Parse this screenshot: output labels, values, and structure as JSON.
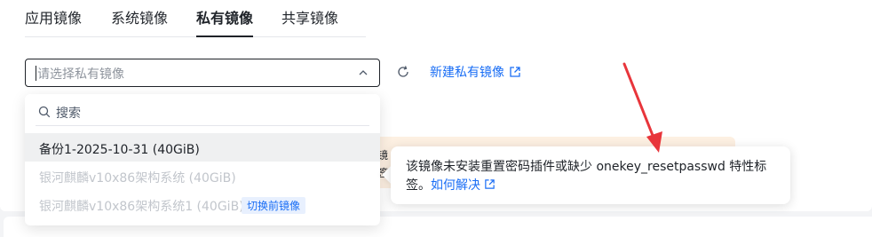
{
  "tabs": [
    {
      "label": "应用镜像",
      "active": false
    },
    {
      "label": "系统镜像",
      "active": false
    },
    {
      "label": "私有镜像",
      "active": true
    },
    {
      "label": "共享镜像",
      "active": false
    }
  ],
  "select": {
    "placeholder": "请选择私有镜像",
    "chevron_icon": "chevron-up-icon"
  },
  "refresh_icon": "refresh-icon",
  "new_image_link": {
    "label": "新建私有镜像",
    "icon": "external-link-icon"
  },
  "dropdown": {
    "search_placeholder": "搜索",
    "search_icon": "search-icon",
    "items": [
      {
        "label": "备份1-2025-10-31 (40GiB)",
        "state": "selected"
      },
      {
        "label": "银河麒麟v10x86架构系统 (40GiB)",
        "state": "disabled"
      },
      {
        "label": "银河麒麟v10x86架构系统1 (40GiB)",
        "state": "disabled",
        "badge": "切换前镜像"
      }
    ]
  },
  "notice": {
    "fragment_1": "镜",
    "fragment_2": "签"
  },
  "tooltip": {
    "line1": "该镜像未安装重置密码插件或缺少 onekey_resetpasswd 特性标",
    "line2_prefix": "签。",
    "link_label": "如何解决",
    "link_icon": "external-link-icon"
  },
  "colors": {
    "accent": "#1a6ef5",
    "notice_bg": "#fdf0e2",
    "annotation_arrow": "#e8353b"
  }
}
